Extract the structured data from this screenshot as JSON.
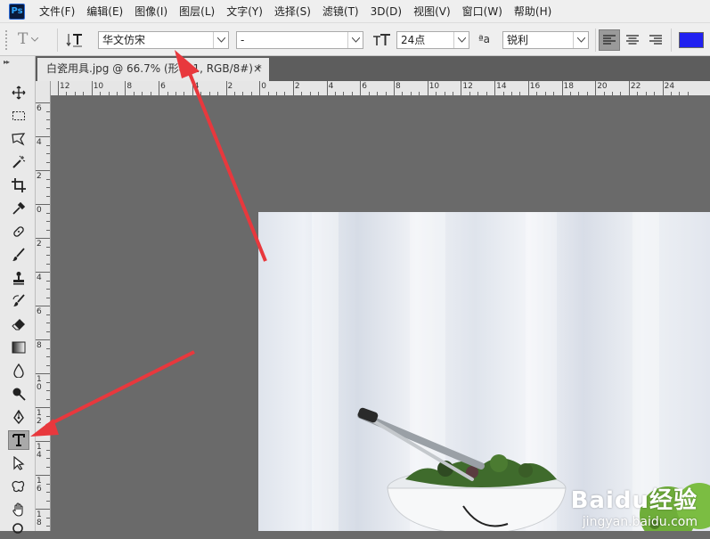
{
  "menu": {
    "logo": "Ps",
    "items": [
      "文件(F)",
      "编辑(E)",
      "图像(I)",
      "图层(L)",
      "文字(Y)",
      "选择(S)",
      "滤镜(T)",
      "3D(D)",
      "视图(V)",
      "窗口(W)",
      "帮助(H)"
    ]
  },
  "options": {
    "tool_preset_glyph": "T",
    "font_family": "华文仿宋",
    "font_style": "-",
    "font_size": "24点",
    "aa_glyph": "ªa",
    "antialias": "锐利",
    "text_color": "#2020f0"
  },
  "document": {
    "tab_title": "白瓷用具.jpg @ 66.7% (形状 1, RGB/8#) *",
    "close_glyph": "×"
  },
  "rulers": {
    "horizontal": [
      "12",
      "10",
      "8",
      "6",
      "4",
      "2",
      "0",
      "2",
      "4",
      "6",
      "8",
      "10",
      "12",
      "14",
      "16",
      "18",
      "20",
      "22",
      "24"
    ],
    "vertical": [
      "6",
      "4",
      "2",
      "0",
      "2",
      "4",
      "6",
      "8",
      "1 0",
      "1 2",
      "1 4",
      "1 6",
      "1 8"
    ]
  },
  "tools": [
    "move",
    "marquee",
    "lasso",
    "magic-wand",
    "crop",
    "eyedropper",
    "healing",
    "brush",
    "stamp",
    "history-brush",
    "eraser",
    "gradient",
    "blur",
    "dodge",
    "pen",
    "type",
    "path-select",
    "shape",
    "hand",
    "zoom"
  ],
  "active_tool": "type",
  "watermark": {
    "logo": "Baidu经验",
    "url": "jingyan.baidu.com"
  },
  "annotation_color": "#e8383d"
}
